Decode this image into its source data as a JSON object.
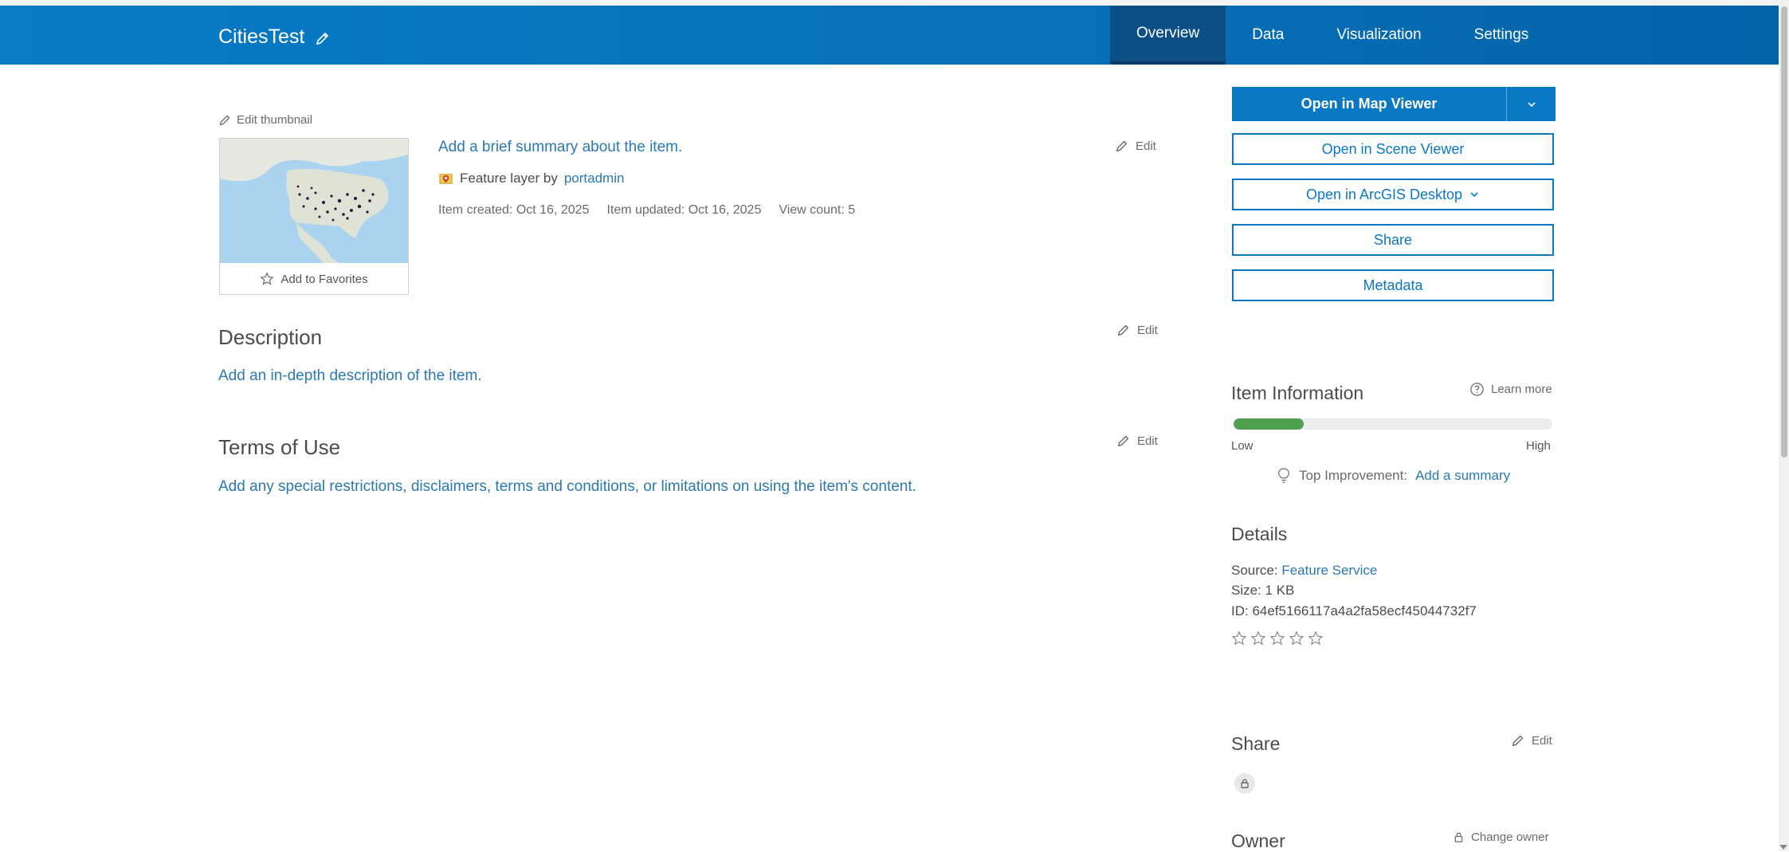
{
  "header": {
    "title": "CitiesTest",
    "tabs": [
      {
        "label": "Overview",
        "active": true
      },
      {
        "label": "Data",
        "active": false
      },
      {
        "label": "Visualization",
        "active": false
      },
      {
        "label": "Settings",
        "active": false
      }
    ]
  },
  "thumbnail": {
    "edit_label": "Edit thumbnail",
    "favorites_label": "Add to Favorites"
  },
  "summary": {
    "text": "Add a brief summary about the item.",
    "edit_label": "Edit",
    "type_prefix": "Feature layer by",
    "owner": "portadmin",
    "created": "Item created: Oct 16, 2025",
    "updated": "Item updated: Oct 16, 2025",
    "views": "View count: 5"
  },
  "description": {
    "title": "Description",
    "edit_label": "Edit",
    "text": "Add an in-depth description of the item."
  },
  "terms": {
    "title": "Terms of Use",
    "edit_label": "Edit",
    "text": "Add any special restrictions, disclaimers, terms and conditions, or limitations on using the item's content."
  },
  "actions": {
    "map_viewer": "Open in Map Viewer",
    "scene_viewer": "Open in Scene Viewer",
    "arcgis_desktop": "Open in ArcGIS Desktop",
    "share": "Share",
    "metadata": "Metadata"
  },
  "item_info": {
    "title": "Item Information",
    "learn_more": "Learn more",
    "score_fraction": 0.22,
    "low": "Low",
    "high": "High",
    "improvement_label": "Top Improvement:",
    "improvement_link": "Add a summary"
  },
  "details": {
    "title": "Details",
    "source_label": "Source:",
    "source_value": "Feature Service",
    "size": "Size: 1 KB",
    "id": "ID: 64ef5166117a4a2fa58ecf45044732f7",
    "rating": 0
  },
  "share_section": {
    "title": "Share",
    "edit_label": "Edit"
  },
  "owner_section": {
    "title": "Owner",
    "change_owner": "Change owner"
  },
  "colors": {
    "header": "#0670b8",
    "accent": "#0a78c2",
    "link": "#2a7ab0",
    "meter": "#4e9e4e"
  }
}
